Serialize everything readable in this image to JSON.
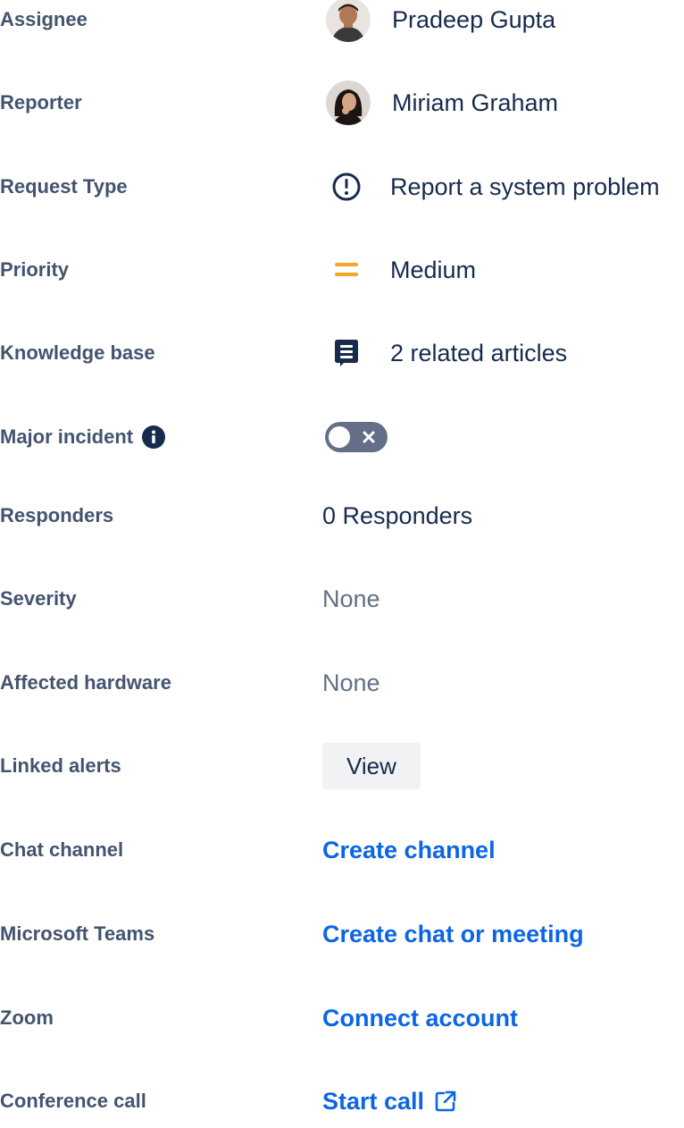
{
  "colors": {
    "label": "#44546f",
    "value": "#172b4d",
    "muted": "#626f86",
    "link": "#0c66e4",
    "priority_medium": "#f5a623",
    "toggle_off": "#626f86",
    "button_bg": "#f1f2f4",
    "info_icon": "#172b4d"
  },
  "fields": {
    "assignee": {
      "label": "Assignee",
      "value": "Pradeep Gupta",
      "icon": "avatar-pradeep"
    },
    "reporter": {
      "label": "Reporter",
      "value": "Miriam Graham",
      "icon": "avatar-miriam"
    },
    "request_type": {
      "label": "Request Type",
      "value": "Report a system problem",
      "icon": "exclamation-circle-icon"
    },
    "priority": {
      "label": "Priority",
      "value": "Medium",
      "icon": "priority-medium-icon"
    },
    "knowledge_base": {
      "label": "Knowledge base",
      "value": "2 related articles",
      "icon": "article-icon"
    },
    "major_incident": {
      "label": "Major incident",
      "info_icon": "info-icon",
      "toggle_state": "off"
    },
    "responders": {
      "label": "Responders",
      "value": "0 Responders"
    },
    "severity": {
      "label": "Severity",
      "value": "None"
    },
    "affected_hardware": {
      "label": "Affected hardware",
      "value": "None"
    },
    "linked_alerts": {
      "label": "Linked alerts",
      "button": "View"
    },
    "chat_channel": {
      "label": "Chat channel",
      "link": "Create channel"
    },
    "microsoft_teams": {
      "label": "Microsoft Teams",
      "link": "Create chat or meeting"
    },
    "zoom": {
      "label": "Zoom",
      "link": "Connect account"
    },
    "conference_call": {
      "label": "Conference call",
      "link": "Start call",
      "link_icon": "external-link-icon"
    }
  }
}
